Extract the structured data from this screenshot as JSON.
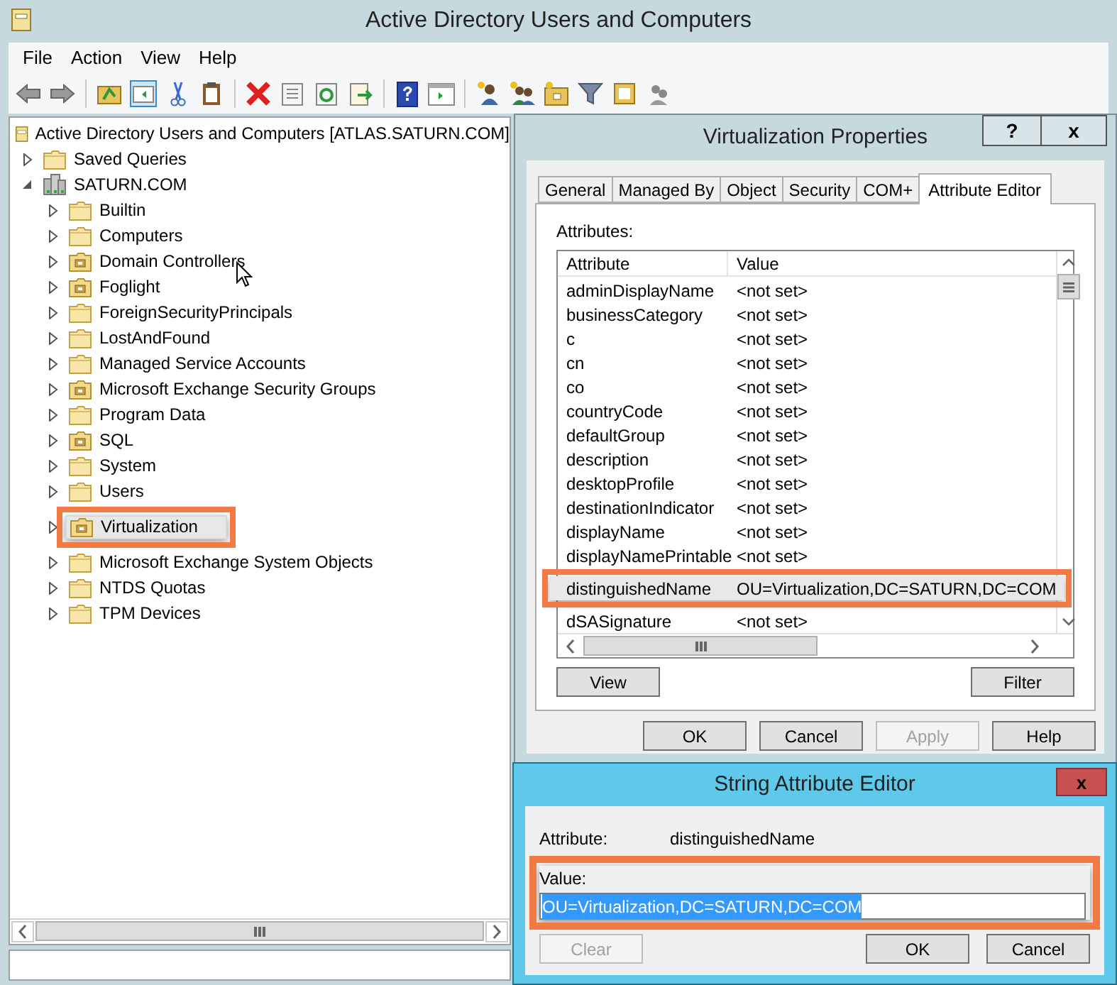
{
  "main_window": {
    "title": "Active Directory Users and Computers",
    "menu": [
      "File",
      "Action",
      "View",
      "Help"
    ]
  },
  "tree": {
    "root": {
      "label": "Active Directory Users and Computers [ATLAS.SATURN.COM]"
    },
    "items": [
      {
        "label": "Saved Queries",
        "kind": "folder",
        "expanded": false,
        "selected": false,
        "highlighted": false
      },
      {
        "label": "SATURN.COM",
        "kind": "domain",
        "expanded": true,
        "selected": false,
        "highlighted": false,
        "children": [
          {
            "label": "Builtin",
            "kind": "folder",
            "expanded": false,
            "selected": false,
            "highlighted": false
          },
          {
            "label": "Computers",
            "kind": "folder",
            "expanded": false,
            "selected": false,
            "highlighted": false
          },
          {
            "label": "Domain Controllers",
            "kind": "ou",
            "expanded": false,
            "selected": false,
            "highlighted": false
          },
          {
            "label": "Foglight",
            "kind": "ou",
            "expanded": false,
            "selected": false,
            "highlighted": false
          },
          {
            "label": "ForeignSecurityPrincipals",
            "kind": "folder",
            "expanded": false,
            "selected": false,
            "highlighted": false
          },
          {
            "label": "LostAndFound",
            "kind": "folder",
            "expanded": false,
            "selected": false,
            "highlighted": false
          },
          {
            "label": "Managed Service Accounts",
            "kind": "folder",
            "expanded": false,
            "selected": false,
            "highlighted": false
          },
          {
            "label": "Microsoft Exchange Security Groups",
            "kind": "ou",
            "expanded": false,
            "selected": false,
            "highlighted": false
          },
          {
            "label": "Program Data",
            "kind": "folder",
            "expanded": false,
            "selected": false,
            "highlighted": false
          },
          {
            "label": "SQL",
            "kind": "ou",
            "expanded": false,
            "selected": false,
            "highlighted": false
          },
          {
            "label": "System",
            "kind": "folder",
            "expanded": false,
            "selected": false,
            "highlighted": false
          },
          {
            "label": "Users",
            "kind": "folder",
            "expanded": false,
            "selected": false,
            "highlighted": false
          },
          {
            "label": "Virtualization",
            "kind": "ou",
            "expanded": false,
            "selected": true,
            "highlighted": true
          },
          {
            "label": "Microsoft Exchange System Objects",
            "kind": "folder",
            "expanded": false,
            "selected": false,
            "highlighted": false
          },
          {
            "label": "NTDS Quotas",
            "kind": "folder",
            "expanded": false,
            "selected": false,
            "highlighted": false
          },
          {
            "label": "TPM Devices",
            "kind": "folder",
            "expanded": false,
            "selected": false,
            "highlighted": false
          }
        ]
      }
    ]
  },
  "properties": {
    "title": "Virtualization Properties",
    "help_button": "?",
    "close_button": "x",
    "tabs": [
      {
        "label": "General",
        "selected": false
      },
      {
        "label": "Managed By",
        "selected": false
      },
      {
        "label": "Object",
        "selected": false
      },
      {
        "label": "Security",
        "selected": false
      },
      {
        "label": "COM+",
        "selected": false
      },
      {
        "label": "Attribute Editor",
        "selected": true
      }
    ],
    "attributes_label": "Attributes:",
    "columns": [
      "Attribute",
      "Value"
    ],
    "rows": [
      {
        "attribute": "adminDisplayName",
        "value": "<not set>",
        "selected": false,
        "highlighted": false
      },
      {
        "attribute": "businessCategory",
        "value": "<not set>",
        "selected": false,
        "highlighted": false
      },
      {
        "attribute": "c",
        "value": "<not set>",
        "selected": false,
        "highlighted": false
      },
      {
        "attribute": "cn",
        "value": "<not set>",
        "selected": false,
        "highlighted": false
      },
      {
        "attribute": "co",
        "value": "<not set>",
        "selected": false,
        "highlighted": false
      },
      {
        "attribute": "countryCode",
        "value": "<not set>",
        "selected": false,
        "highlighted": false
      },
      {
        "attribute": "defaultGroup",
        "value": "<not set>",
        "selected": false,
        "highlighted": false
      },
      {
        "attribute": "description",
        "value": "<not set>",
        "selected": false,
        "highlighted": false
      },
      {
        "attribute": "desktopProfile",
        "value": "<not set>",
        "selected": false,
        "highlighted": false
      },
      {
        "attribute": "destinationIndicator",
        "value": "<not set>",
        "selected": false,
        "highlighted": false
      },
      {
        "attribute": "displayName",
        "value": "<not set>",
        "selected": false,
        "highlighted": false
      },
      {
        "attribute": "displayNamePrintable",
        "value": "<not set>",
        "selected": false,
        "highlighted": false
      },
      {
        "attribute": "distinguishedName",
        "value": "OU=Virtualization,DC=SATURN,DC=COM",
        "selected": true,
        "highlighted": true
      },
      {
        "attribute": "dSASignature",
        "value": "<not set>",
        "selected": false,
        "highlighted": false
      }
    ],
    "list_buttons": [
      "View",
      "Filter"
    ],
    "footer_buttons": [
      {
        "label": "OK",
        "disabled": false
      },
      {
        "label": "Cancel",
        "disabled": false
      },
      {
        "label": "Apply",
        "disabled": true
      },
      {
        "label": "Help",
        "disabled": false
      }
    ]
  },
  "string_editor": {
    "title": "String Attribute Editor",
    "close_button": "x",
    "attribute_label": "Attribute:",
    "attribute_value": "distinguishedName",
    "value_label": "Value:",
    "value": "OU=Virtualization,DC=SATURN,DC=COM",
    "value_selected": true,
    "highlighted": true,
    "buttons": [
      {
        "label": "Clear",
        "disabled": true
      },
      {
        "label": "OK",
        "disabled": false
      },
      {
        "label": "Cancel",
        "disabled": false
      }
    ]
  }
}
